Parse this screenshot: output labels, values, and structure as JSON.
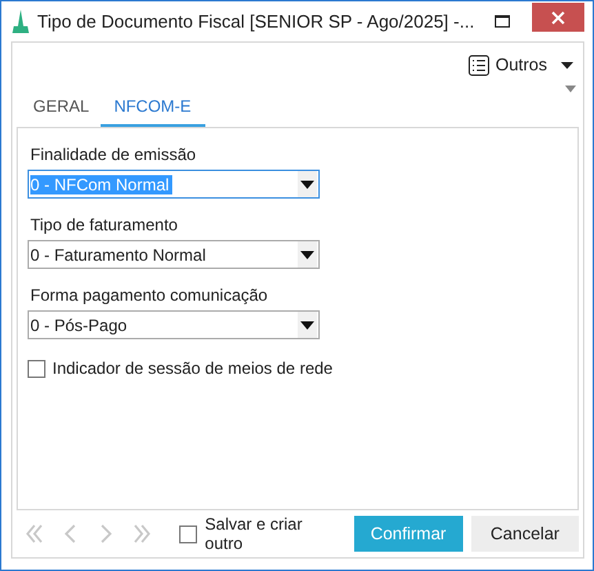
{
  "window": {
    "title": "Tipo de Documento Fiscal [SENIOR SP - Ago/2025]  -..."
  },
  "toolbar": {
    "menu_label": "Outros"
  },
  "tabs": [
    {
      "label": "GERAL",
      "selected": false
    },
    {
      "label": "NFCOM-E",
      "selected": true
    }
  ],
  "fields": [
    {
      "label": "Finalidade de emissão",
      "value": "0 - NFCom Normal",
      "focused": true
    },
    {
      "label": "Tipo de faturamento",
      "value": "0 - Faturamento Normal",
      "focused": false
    },
    {
      "label": "Forma pagamento comunicação",
      "value": "0 - Pós-Pago",
      "focused": false
    }
  ],
  "checkbox": {
    "label": "Indicador de sessão de meios de rede",
    "checked": false
  },
  "footer": {
    "save_and_new": {
      "label": "Salvar e criar outro",
      "checked": false
    },
    "buttons": [
      {
        "label": "Confirmar",
        "kind": "primary"
      },
      {
        "label": "Cancelar",
        "kind": "secondary"
      }
    ]
  }
}
